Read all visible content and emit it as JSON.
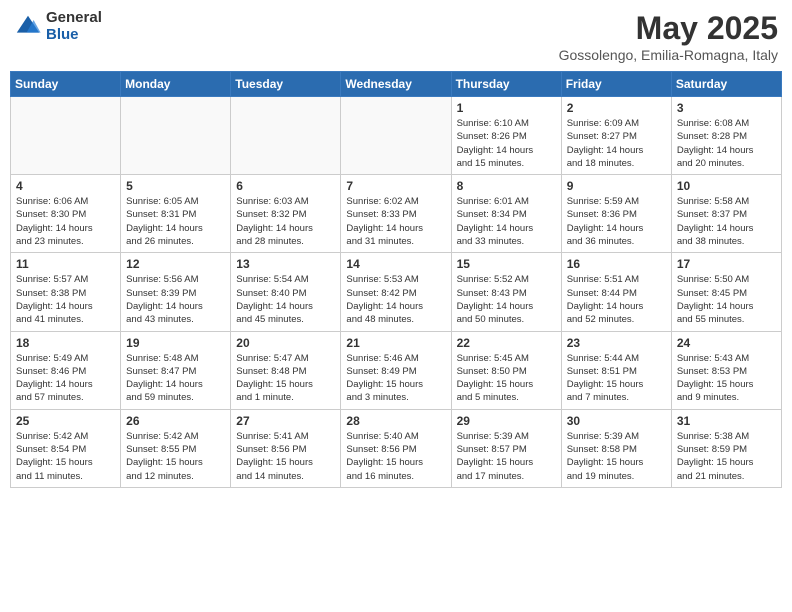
{
  "logo": {
    "general": "General",
    "blue": "Blue"
  },
  "title": {
    "month": "May 2025",
    "location": "Gossolengo, Emilia-Romagna, Italy"
  },
  "weekdays": [
    "Sunday",
    "Monday",
    "Tuesday",
    "Wednesday",
    "Thursday",
    "Friday",
    "Saturday"
  ],
  "weeks": [
    [
      {
        "day": "",
        "info": ""
      },
      {
        "day": "",
        "info": ""
      },
      {
        "day": "",
        "info": ""
      },
      {
        "day": "",
        "info": ""
      },
      {
        "day": "1",
        "info": "Sunrise: 6:10 AM\nSunset: 8:26 PM\nDaylight: 14 hours\nand 15 minutes."
      },
      {
        "day": "2",
        "info": "Sunrise: 6:09 AM\nSunset: 8:27 PM\nDaylight: 14 hours\nand 18 minutes."
      },
      {
        "day": "3",
        "info": "Sunrise: 6:08 AM\nSunset: 8:28 PM\nDaylight: 14 hours\nand 20 minutes."
      }
    ],
    [
      {
        "day": "4",
        "info": "Sunrise: 6:06 AM\nSunset: 8:30 PM\nDaylight: 14 hours\nand 23 minutes."
      },
      {
        "day": "5",
        "info": "Sunrise: 6:05 AM\nSunset: 8:31 PM\nDaylight: 14 hours\nand 26 minutes."
      },
      {
        "day": "6",
        "info": "Sunrise: 6:03 AM\nSunset: 8:32 PM\nDaylight: 14 hours\nand 28 minutes."
      },
      {
        "day": "7",
        "info": "Sunrise: 6:02 AM\nSunset: 8:33 PM\nDaylight: 14 hours\nand 31 minutes."
      },
      {
        "day": "8",
        "info": "Sunrise: 6:01 AM\nSunset: 8:34 PM\nDaylight: 14 hours\nand 33 minutes."
      },
      {
        "day": "9",
        "info": "Sunrise: 5:59 AM\nSunset: 8:36 PM\nDaylight: 14 hours\nand 36 minutes."
      },
      {
        "day": "10",
        "info": "Sunrise: 5:58 AM\nSunset: 8:37 PM\nDaylight: 14 hours\nand 38 minutes."
      }
    ],
    [
      {
        "day": "11",
        "info": "Sunrise: 5:57 AM\nSunset: 8:38 PM\nDaylight: 14 hours\nand 41 minutes."
      },
      {
        "day": "12",
        "info": "Sunrise: 5:56 AM\nSunset: 8:39 PM\nDaylight: 14 hours\nand 43 minutes."
      },
      {
        "day": "13",
        "info": "Sunrise: 5:54 AM\nSunset: 8:40 PM\nDaylight: 14 hours\nand 45 minutes."
      },
      {
        "day": "14",
        "info": "Sunrise: 5:53 AM\nSunset: 8:42 PM\nDaylight: 14 hours\nand 48 minutes."
      },
      {
        "day": "15",
        "info": "Sunrise: 5:52 AM\nSunset: 8:43 PM\nDaylight: 14 hours\nand 50 minutes."
      },
      {
        "day": "16",
        "info": "Sunrise: 5:51 AM\nSunset: 8:44 PM\nDaylight: 14 hours\nand 52 minutes."
      },
      {
        "day": "17",
        "info": "Sunrise: 5:50 AM\nSunset: 8:45 PM\nDaylight: 14 hours\nand 55 minutes."
      }
    ],
    [
      {
        "day": "18",
        "info": "Sunrise: 5:49 AM\nSunset: 8:46 PM\nDaylight: 14 hours\nand 57 minutes."
      },
      {
        "day": "19",
        "info": "Sunrise: 5:48 AM\nSunset: 8:47 PM\nDaylight: 14 hours\nand 59 minutes."
      },
      {
        "day": "20",
        "info": "Sunrise: 5:47 AM\nSunset: 8:48 PM\nDaylight: 15 hours\nand 1 minute."
      },
      {
        "day": "21",
        "info": "Sunrise: 5:46 AM\nSunset: 8:49 PM\nDaylight: 15 hours\nand 3 minutes."
      },
      {
        "day": "22",
        "info": "Sunrise: 5:45 AM\nSunset: 8:50 PM\nDaylight: 15 hours\nand 5 minutes."
      },
      {
        "day": "23",
        "info": "Sunrise: 5:44 AM\nSunset: 8:51 PM\nDaylight: 15 hours\nand 7 minutes."
      },
      {
        "day": "24",
        "info": "Sunrise: 5:43 AM\nSunset: 8:53 PM\nDaylight: 15 hours\nand 9 minutes."
      }
    ],
    [
      {
        "day": "25",
        "info": "Sunrise: 5:42 AM\nSunset: 8:54 PM\nDaylight: 15 hours\nand 11 minutes."
      },
      {
        "day": "26",
        "info": "Sunrise: 5:42 AM\nSunset: 8:55 PM\nDaylight: 15 hours\nand 12 minutes."
      },
      {
        "day": "27",
        "info": "Sunrise: 5:41 AM\nSunset: 8:56 PM\nDaylight: 15 hours\nand 14 minutes."
      },
      {
        "day": "28",
        "info": "Sunrise: 5:40 AM\nSunset: 8:56 PM\nDaylight: 15 hours\nand 16 minutes."
      },
      {
        "day": "29",
        "info": "Sunrise: 5:39 AM\nSunset: 8:57 PM\nDaylight: 15 hours\nand 17 minutes."
      },
      {
        "day": "30",
        "info": "Sunrise: 5:39 AM\nSunset: 8:58 PM\nDaylight: 15 hours\nand 19 minutes."
      },
      {
        "day": "31",
        "info": "Sunrise: 5:38 AM\nSunset: 8:59 PM\nDaylight: 15 hours\nand 21 minutes."
      }
    ]
  ]
}
